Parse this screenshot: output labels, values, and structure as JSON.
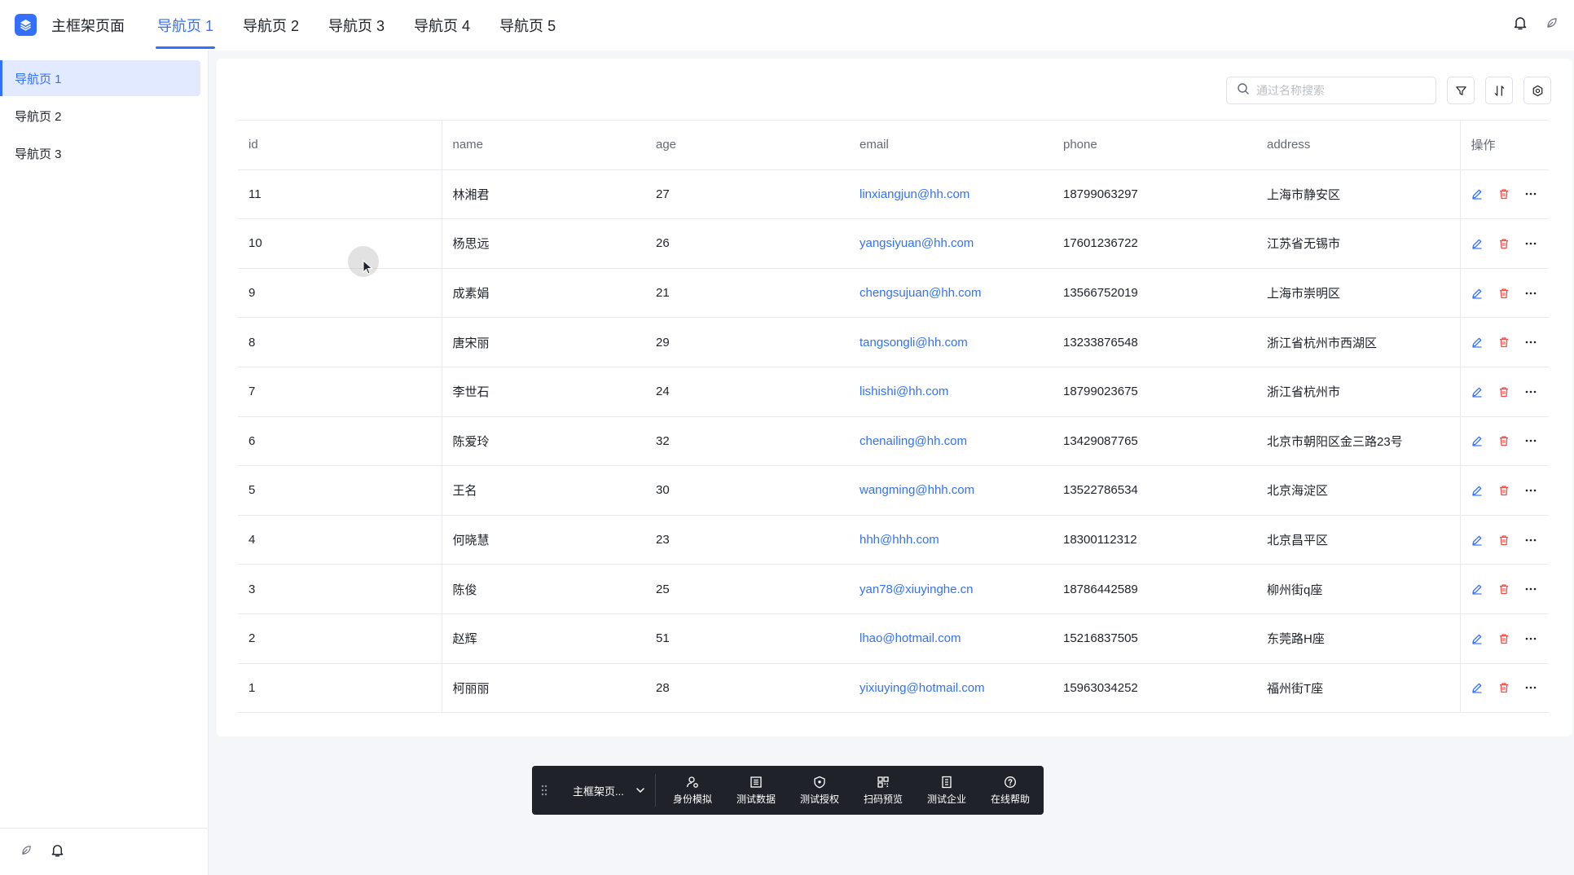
{
  "header": {
    "app_title": "主框架页面",
    "nav": [
      "导航页 1",
      "导航页 2",
      "导航页 3",
      "导航页 4",
      "导航页 5"
    ],
    "active_nav": 0,
    "icons": [
      "bell-icon",
      "leaf-icon"
    ]
  },
  "sidebar": {
    "items": [
      "导航页 1",
      "导航页 2",
      "导航页 3"
    ],
    "active": 0,
    "footer_icons": [
      "leaf-icon",
      "bell-icon"
    ]
  },
  "toolbar": {
    "search_placeholder": "通过名称搜索",
    "icons": [
      "filter-icon",
      "sort-icon",
      "settings-icon"
    ]
  },
  "table": {
    "headers": {
      "id": "id",
      "name": "name",
      "age": "age",
      "email": "email",
      "phone": "phone",
      "address": "address",
      "ops": "操作"
    },
    "rows": [
      {
        "id": "11",
        "name": "林湘君",
        "age": "27",
        "email": "linxiangjun@hh.com",
        "phone": "18799063297",
        "address": "上海市静安区"
      },
      {
        "id": "10",
        "name": "杨思远",
        "age": "26",
        "email": "yangsiyuan@hh.com",
        "phone": "17601236722",
        "address": "江苏省无锡市"
      },
      {
        "id": "9",
        "name": "成素娟",
        "age": "21",
        "email": "chengsujuan@hh.com",
        "phone": "13566752019",
        "address": "上海市崇明区"
      },
      {
        "id": "8",
        "name": "唐宋丽",
        "age": "29",
        "email": "tangsongli@hh.com",
        "phone": "13233876548",
        "address": "浙江省杭州市西湖区"
      },
      {
        "id": "7",
        "name": "李世石",
        "age": "24",
        "email": "lishishi@hh.com",
        "phone": "18799023675",
        "address": "浙江省杭州市"
      },
      {
        "id": "6",
        "name": "陈爱玲",
        "age": "32",
        "email": "chenailing@hh.com",
        "phone": "13429087765",
        "address": "北京市朝阳区金三路23号"
      },
      {
        "id": "5",
        "name": "王名",
        "age": "30",
        "email": "wangming@hhh.com",
        "phone": "13522786534",
        "address": "北京海淀区"
      },
      {
        "id": "4",
        "name": "何晓慧",
        "age": "23",
        "email": "hhh@hhh.com",
        "phone": "18300112312",
        "address": "北京昌平区"
      },
      {
        "id": "3",
        "name": "陈俊",
        "age": "25",
        "email": "yan78@xiuyinghe.cn",
        "phone": "18786442589",
        "address": "柳州街q座"
      },
      {
        "id": "2",
        "name": "赵辉",
        "age": "51",
        "email": "lhao@hotmail.com",
        "phone": "15216837505",
        "address": "东莞路H座"
      },
      {
        "id": "1",
        "name": "柯丽丽",
        "age": "28",
        "email": "yixiuying@hotmail.com",
        "phone": "15963034252",
        "address": "福州街T座"
      }
    ],
    "row_actions": [
      "edit-icon",
      "delete-icon",
      "more-icon"
    ]
  },
  "devbar": {
    "select_label": "主框架页...",
    "items": [
      {
        "label": "身份模拟",
        "icon": "user-switch-icon"
      },
      {
        "label": "测试数据",
        "icon": "data-table-icon"
      },
      {
        "label": "测试授权",
        "icon": "shield-icon"
      },
      {
        "label": "扫码预览",
        "icon": "qrcode-icon"
      },
      {
        "label": "测试企业",
        "icon": "company-icon"
      },
      {
        "label": "在线帮助",
        "icon": "help-icon"
      }
    ]
  },
  "colors": {
    "primary": "#3370ff",
    "danger": "#f54a45",
    "text": "#1f2329",
    "muted": "#646a73",
    "devbar": "#1f2329"
  }
}
